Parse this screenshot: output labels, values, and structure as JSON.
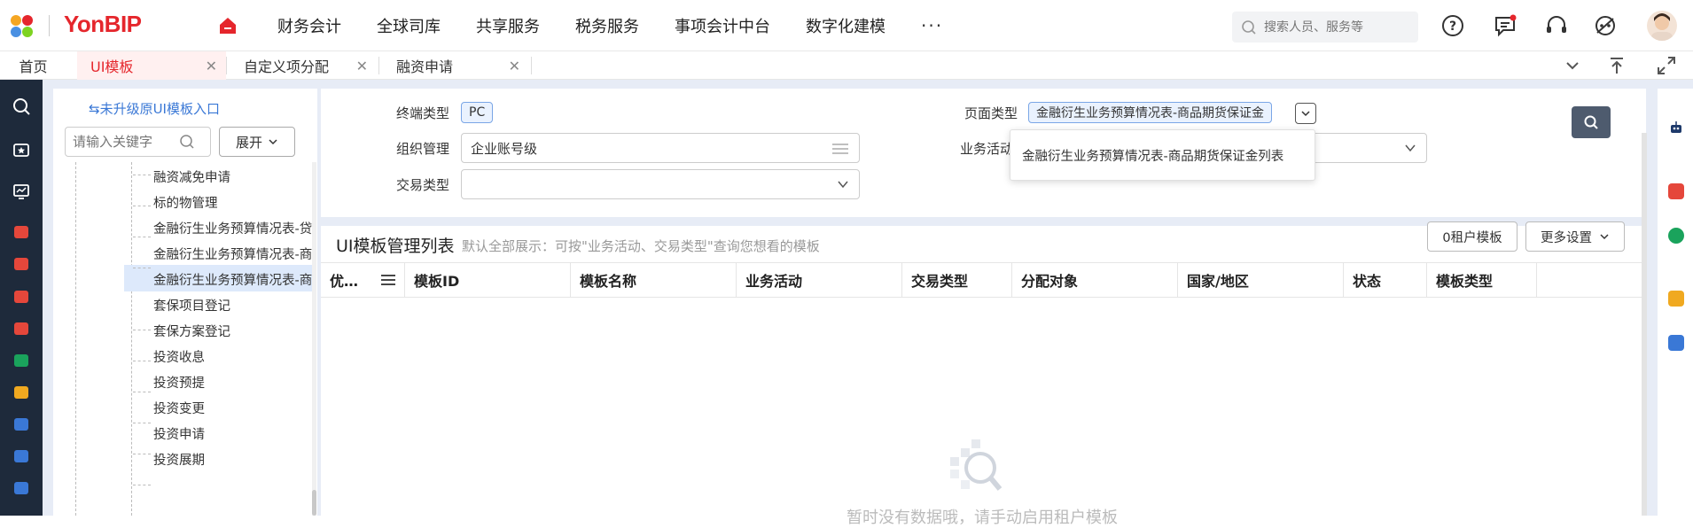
{
  "header": {
    "logo_text": "YonBIP",
    "nav": [
      "财务会计",
      "全球司库",
      "共享服务",
      "税务服务",
      "事项会计中台",
      "数字化建模"
    ],
    "nav_more": "···",
    "search_placeholder": "搜索人员、服务等"
  },
  "tabs": [
    {
      "label": "首页",
      "active": false,
      "closable": false
    },
    {
      "label": "UI模板",
      "active": true,
      "closable": true
    },
    {
      "label": "自定义项分配",
      "active": false,
      "closable": true
    },
    {
      "label": "融资申请",
      "active": false,
      "closable": true
    }
  ],
  "tree": {
    "legacy_link": "⇆未升级原UI模板入口",
    "search_placeholder": "请输入关键字",
    "expand_label": "展开",
    "items": [
      "融资减免申请",
      "标的物管理",
      "金融衍生业务预算情况表-贷款",
      "金融衍生业务预算情况表-商品",
      "金融衍生业务预算情况表-商品期货保证金",
      "套保项目登记",
      "套保方案登记",
      "投资收息",
      "投资预提",
      "投资变更",
      "投资申请",
      "投资展期"
    ],
    "selected_index": 4
  },
  "filters": {
    "terminal_label": "终端类型",
    "terminal_value": "PC",
    "org_label": "组织管理",
    "org_value": "企业账号级",
    "trade_label": "交易类型",
    "trade_value": "",
    "page_label": "页面类型",
    "page_value": "金融衍生业务预算情况表-商品期货保证金",
    "biz_label": "业务活动",
    "popup_option": "金融衍生业务预算情况表-商品期货保证金列表"
  },
  "list": {
    "title": "UI模板管理列表",
    "hint": "默认全部展示：可按\"业务活动、交易类型\"查询您想看的模板",
    "tenant_btn": "0租户模板",
    "more_btn": "更多设置",
    "columns": [
      "优…",
      "模板ID",
      "模板名称",
      "业务活动",
      "交易类型",
      "分配对象",
      "国家/地区",
      "状态",
      "模板类型"
    ],
    "empty_text": "暂时没有数据哦，请手动启用租户模板"
  },
  "colors": {
    "brand": "#e5262c",
    "rail": "#1e2a3b",
    "accent": "#3a78d6"
  }
}
